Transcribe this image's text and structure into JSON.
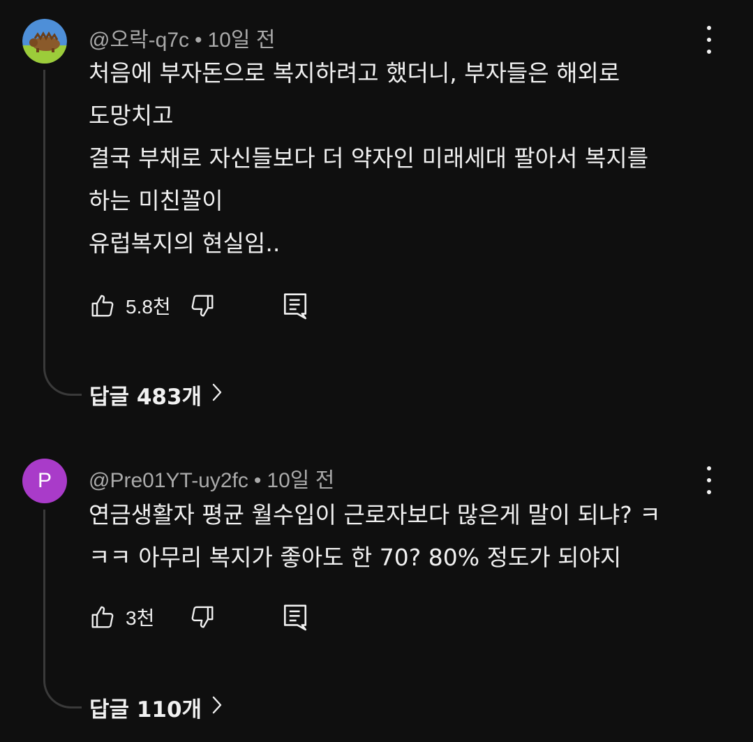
{
  "comments": [
    {
      "author": "@오락-q7c",
      "separator": "•",
      "time": "10일 전",
      "avatar_letter": "",
      "lines": [
        "처음에 부자돈으로 복지하려고 했더니,   부자들은 해외로",
        "도망치고",
        "결국 부채로 자신들보다 더 약자인 미래세대 팔아서 복지를",
        "하는 미친꼴이",
        "유럽복지의 현실임.."
      ],
      "likes": "5.8천",
      "replies_label": "답글 483개"
    },
    {
      "author": "@Pre01YT-uy2fc",
      "separator": "•",
      "time": "10일 전",
      "avatar_letter": "P",
      "lines": [
        "연금생활자 평균 월수입이 근로자보다 많은게 말이 되냐? ㅋ",
        "ㅋㅋ 아무리 복지가 좋아도 한 70? 80% 정도가 되야지"
      ],
      "likes": "3천",
      "replies_label": "답글 110개"
    }
  ],
  "icons": {
    "like": "thumbs-up-icon",
    "dislike": "thumbs-down-icon",
    "reply": "comment-reply-icon",
    "menu": "more-vertical-icon",
    "chevron": "chevron-right-icon"
  },
  "colors": {
    "background": "#0f0f0f",
    "text": "#f1f1f1",
    "meta": "#aaaaaa",
    "avatar_p": "#a93bc9",
    "thread_line": "#3a3a3a"
  }
}
